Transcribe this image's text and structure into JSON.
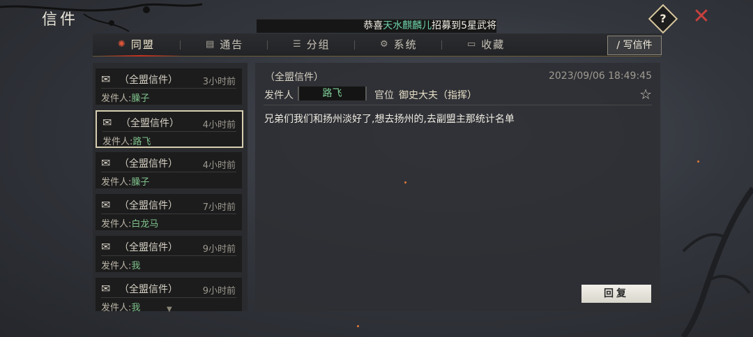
{
  "window": {
    "title": "信件"
  },
  "header": {
    "help_label": "?",
    "close_label": "✕"
  },
  "marquee": {
    "prefix": "恭喜",
    "highlight": "天水麒麟儿",
    "suffix": "招募到5星武将"
  },
  "tabs": [
    {
      "label": "同盟",
      "icon": "alliance-icon"
    },
    {
      "label": "通告",
      "icon": "notice-icon"
    },
    {
      "label": "分组",
      "icon": "group-icon"
    },
    {
      "label": "系统",
      "icon": "system-gear-icon"
    },
    {
      "label": "收藏",
      "icon": "favorite-box-icon"
    }
  ],
  "write_button": {
    "label": "写信件"
  },
  "mail_list": [
    {
      "type": "（全盟信件）",
      "time": "3小时前",
      "sender_label": "发件人:",
      "sender": "臊子"
    },
    {
      "type": "（全盟信件）",
      "time": "4小时前",
      "sender_label": "发件人:",
      "sender": "路飞"
    },
    {
      "type": "（全盟信件）",
      "time": "4小时前",
      "sender_label": "发件人:",
      "sender": "臊子"
    },
    {
      "type": "（全盟信件）",
      "time": "7小时前",
      "sender_label": "发件人:",
      "sender": "白龙马"
    },
    {
      "type": "（全盟信件）",
      "time": "9小时前",
      "sender_label": "发件人:",
      "sender": "我"
    },
    {
      "type": "（全盟信件）",
      "time": "9小时前",
      "sender_label": "发件人:",
      "sender": "我"
    }
  ],
  "detail": {
    "type": "（全盟信件）",
    "date": "2023/09/06 18:49:45",
    "sender_label": "发件人",
    "sender": "路飞",
    "rank_label": "官位",
    "rank": "御史大夫（指挥）",
    "body": "兄弟们我们和扬州淡好了,想去扬州的,去副盟主那统计名单"
  },
  "reply_button": {
    "label": "回复"
  },
  "colors": {
    "accent_green": "#7fd29a",
    "close_red": "#c8403e",
    "tab_active_red": "#c9321f"
  }
}
